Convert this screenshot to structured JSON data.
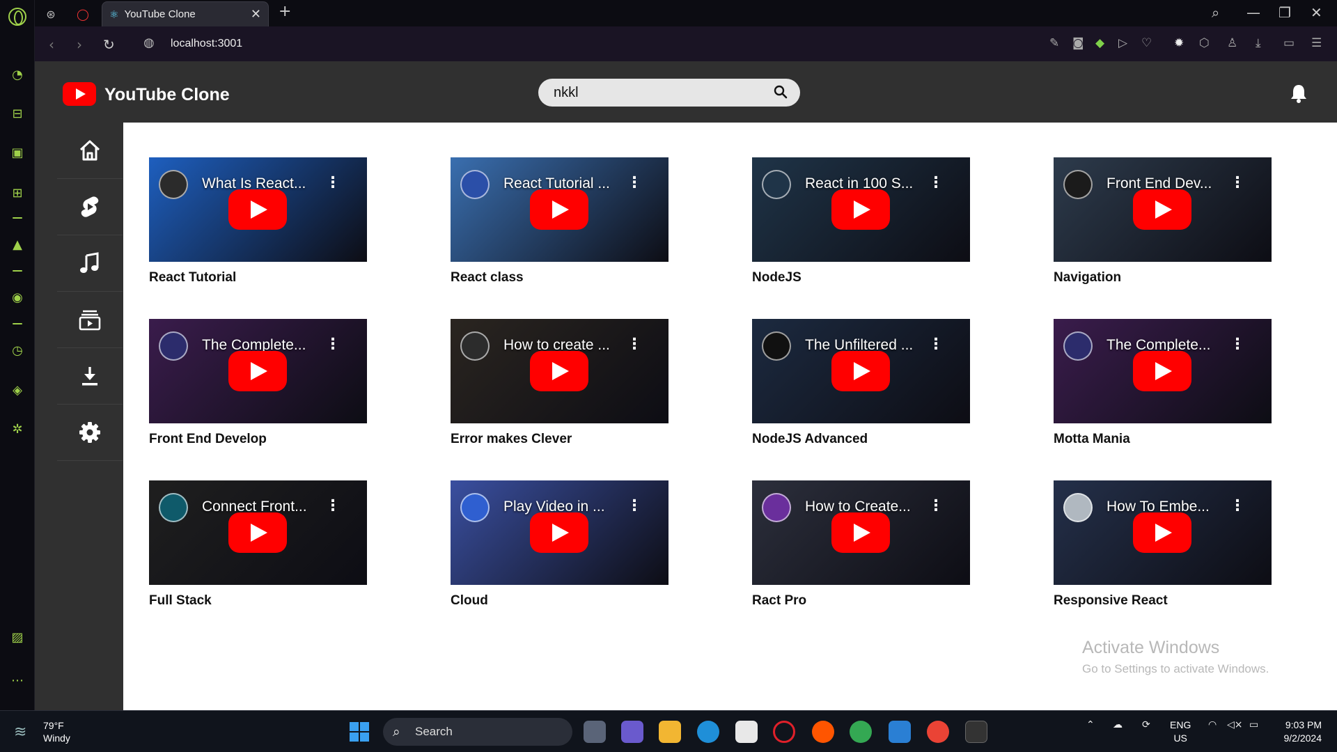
{
  "browser": {
    "tab_title": "YouTube Clone",
    "url": "localhost:3001"
  },
  "app": {
    "title": "YouTube Clone",
    "search_value": "nkkl"
  },
  "sidebar": {
    "items": [
      {
        "icon": "home-icon"
      },
      {
        "icon": "shorts-icon"
      },
      {
        "icon": "music-icon"
      },
      {
        "icon": "subscriptions-icon"
      },
      {
        "icon": "download-icon"
      },
      {
        "icon": "settings-icon"
      }
    ]
  },
  "videos": [
    {
      "thumb_title": "What Is React...",
      "label": "React Tutorial",
      "bg": "#1e5fbf",
      "ch": "#2b2b2b"
    },
    {
      "thumb_title": "React Tutorial ...",
      "label": "React class",
      "bg": "#3a6fb0",
      "ch": "#2b4fa8"
    },
    {
      "thumb_title": "React in 100 S...",
      "label": "NodeJS",
      "bg": "#1f3448",
      "ch": "#1f3448"
    },
    {
      "thumb_title": "Front End Dev...",
      "label": "Navigation",
      "bg": "#2d3b4c",
      "ch": "#1b1b1b"
    },
    {
      "thumb_title": "The Complete...",
      "label": "Front End Develop",
      "bg": "#3a1c4c",
      "ch": "#2c2c6c"
    },
    {
      "thumb_title": "How to create ...",
      "label": "Error makes Clever",
      "bg": "#2a2520",
      "ch": "#2c2c2c"
    },
    {
      "thumb_title": "The Unfiltered ...",
      "label": "NodeJS Advanced",
      "bg": "#1c2a40",
      "ch": "#111111"
    },
    {
      "thumb_title": "The Complete...",
      "label": "Motta Mania",
      "bg": "#3a1c4c",
      "ch": "#2c2c6c"
    },
    {
      "thumb_title": "Connect Front...",
      "label": "Full Stack",
      "bg": "#1f1f1f",
      "ch": "#0f5a6a"
    },
    {
      "thumb_title": "Play Video in ...",
      "label": "Cloud",
      "bg": "#3a4fa0",
      "ch": "#2f5fd0"
    },
    {
      "thumb_title": "How to Create...",
      "label": "Ract Pro",
      "bg": "#2c2f3c",
      "ch": "#6a2f9c"
    },
    {
      "thumb_title": "How To Embe...",
      "label": "Responsive React",
      "bg": "#24304a",
      "ch": "#b0b8c0"
    }
  ],
  "watermark": {
    "line1": "Activate Windows",
    "line2": "Go to Settings to activate Windows."
  },
  "taskbar": {
    "temp": "79°F",
    "condition": "Windy",
    "search_label": "Search",
    "lang1": "ENG",
    "lang2": "US",
    "time": "9:03 PM",
    "date": "9/2/2024"
  }
}
